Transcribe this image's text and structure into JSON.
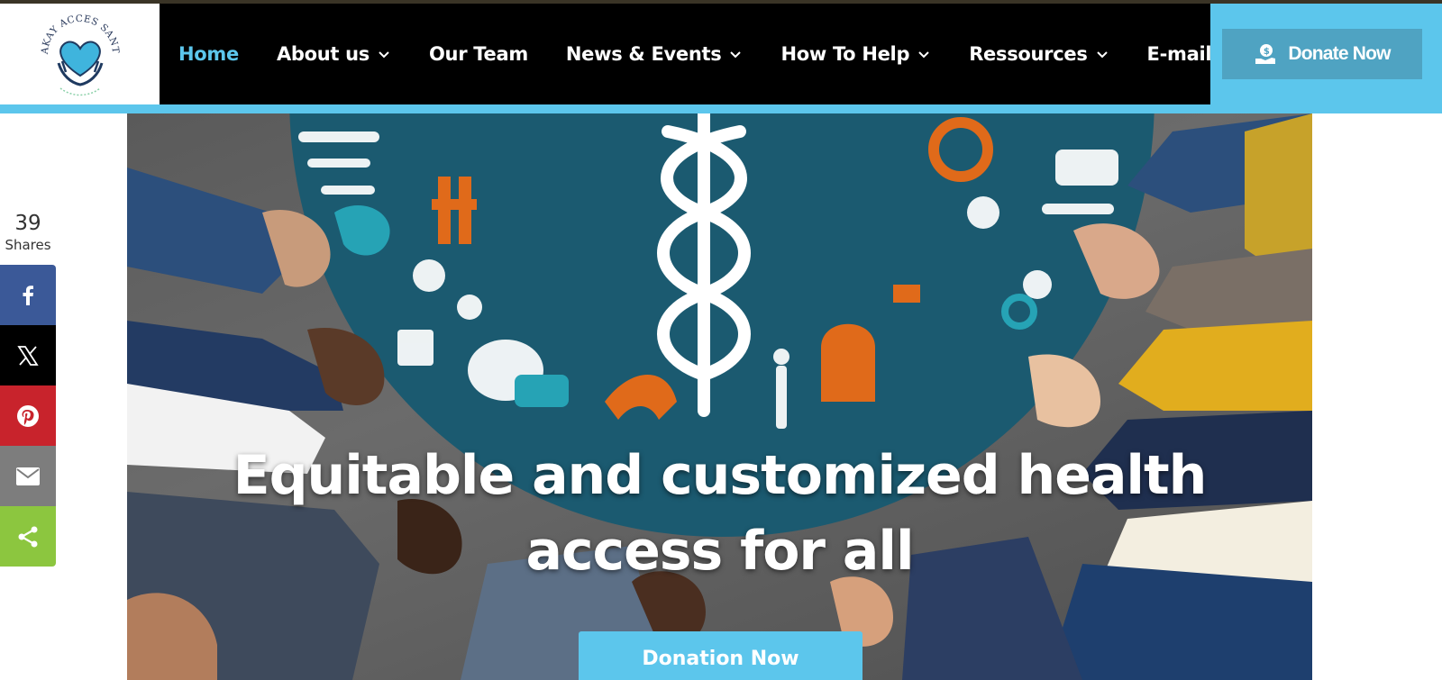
{
  "logo": {
    "name": "LAKAY ACCES SANTE",
    "tagline": "health access for all"
  },
  "nav": {
    "items": [
      {
        "label": "Home",
        "dropdown": false,
        "active": true
      },
      {
        "label": "About us",
        "dropdown": true,
        "active": false
      },
      {
        "label": "Our Team",
        "dropdown": false,
        "active": false
      },
      {
        "label": "News & Events",
        "dropdown": true,
        "active": false
      },
      {
        "label": "How To Help",
        "dropdown": true,
        "active": false
      },
      {
        "label": "Ressources",
        "dropdown": true,
        "active": false
      },
      {
        "label": "E-mail",
        "dropdown": false,
        "active": false
      }
    ],
    "donate_label": "Donate Now"
  },
  "hero": {
    "title_line1": "Equitable and customized health",
    "title_line2": "access for all",
    "cta_label": "Donation Now"
  },
  "share": {
    "count": "39",
    "count_label": "Shares",
    "buttons": [
      "facebook",
      "x",
      "pinterest",
      "email",
      "share"
    ]
  },
  "colors": {
    "accent": "#5cc6ec",
    "nav_bg": "#000000",
    "donate_bg": "#4fa3c2",
    "facebook": "#3b5998",
    "pinterest": "#c8232c",
    "email": "#7d7d7d",
    "share": "#8cc63f"
  }
}
